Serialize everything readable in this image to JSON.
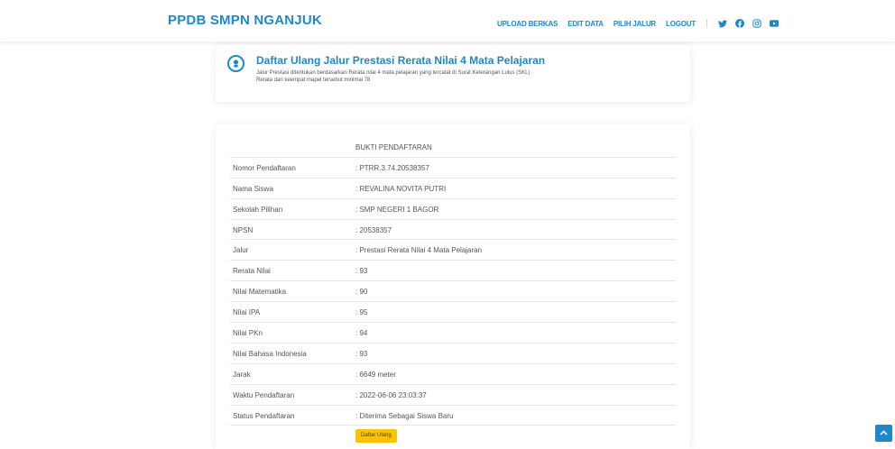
{
  "header": {
    "brand": "PPDB SMPN NGANJUK",
    "nav": [
      "UPLOAD BERKAS",
      "EDIT DATA",
      "PILIH JALUR",
      "LOGOUT"
    ],
    "social_icons": [
      "twitter-icon",
      "facebook-icon",
      "instagram-icon",
      "youtube-icon"
    ]
  },
  "info": {
    "title": "Daftar Ulang Jalur Prestasi Rerata Nilai 4 Mata Pelajaran",
    "line1": "Jalur Prestasi ditentukan berdasarkan Rerata nilai 4 mata pelajaran yang tercatat di Surat Keterangan Lulus (SKL)",
    "line2": "Rerata dari keempat mapel tersebut minimal 78"
  },
  "table": {
    "heading": "BUKTI PENDAFTARAN",
    "rows": [
      {
        "label": "Nomor Pendaftaran",
        "value": ": PTRR.3.74.20538357"
      },
      {
        "label": "Nama Siswa",
        "value": ": REVALINA NOVITA PUTRI"
      },
      {
        "label": "Sekolah Pilihan",
        "value": ": SMP NEGERI 1 BAGOR"
      },
      {
        "label": "NPSN",
        "value": ": 20538357"
      },
      {
        "label": "Jalur",
        "value": ": Prestasi Rerata Nilai 4 Mata Pelajaran"
      },
      {
        "label": "Rerata Nilai",
        "value": ": 93"
      },
      {
        "label": "Nilai Matematika",
        "value": ": 90"
      },
      {
        "label": "Nilai IPA",
        "value": ": 95"
      },
      {
        "label": "Nilai PKn",
        "value": ": 94"
      },
      {
        "label": "Nilai Bahasa Indonesia",
        "value": ": 93"
      },
      {
        "label": "Jarak",
        "value": ": 6649 meter"
      },
      {
        "label": "Waktu Pendaftaran",
        "value": ": 2022-06-06 23:03:37"
      },
      {
        "label": "Status Pendaftaran",
        "value": ": Diterima Sebagai Siswa Baru"
      }
    ],
    "button": "Daftar Ulang"
  },
  "colors": {
    "accent": "#1e88c9",
    "button": "#f7c20c"
  }
}
